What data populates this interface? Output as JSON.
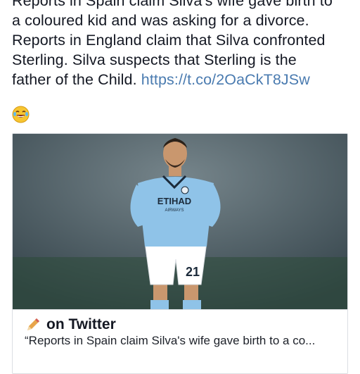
{
  "post": {
    "text_lines": [
      "Reports in Spain claim Silva's wife gave birth to",
      "a coloured kid and was asking for a divorce.",
      "Reports in England claim that Silva confronted",
      "Sterling. Silva suspects that Sterling is the",
      "father of the Child."
    ],
    "link": "https://t.co/2OaCkT8JSw",
    "emoji": "laughing-tears-emoji"
  },
  "card": {
    "image_alt": "Footballer in sky blue kit standing on pitch",
    "jersey_sponsor": "ETIHAD",
    "jersey_sponsor_sub": "AIRWAYS",
    "jersey_number": "21",
    "source": "on Twitter",
    "description": "“Reports in Spain claim Silva's wife gave birth to a co..."
  },
  "colors": {
    "link": "#4a7bb0",
    "kit": "#8fc3e8",
    "shorts": "#ffffff"
  }
}
